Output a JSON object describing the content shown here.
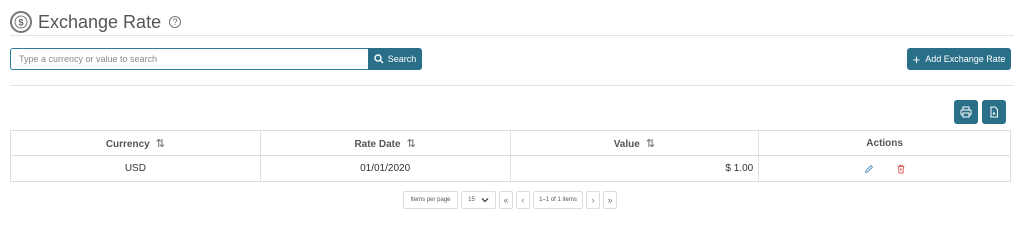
{
  "header": {
    "title": "Exchange Rate",
    "help_symbol": "?"
  },
  "search": {
    "placeholder": "Type a currency or value to search",
    "button_label": "Search"
  },
  "toolbar": {
    "add_label": "Add Exchange Rate",
    "add_symbol": "+"
  },
  "table": {
    "columns": [
      "Currency",
      "Rate Date",
      "Value",
      "Actions"
    ],
    "sort_symbol": "⇅",
    "rows": [
      {
        "currency": "USD",
        "rate_date": "01/01/2020",
        "value": "$ 1.00"
      }
    ]
  },
  "pagination": {
    "items_per_page_label": "Items per page",
    "page_size": "15",
    "first": "«",
    "prev": "‹",
    "range": "1–1 of 1 items",
    "next": "›",
    "last": "»"
  },
  "colors": {
    "primary": "#2a6f88",
    "edit": "#4a90c8",
    "delete": "#e05a5a",
    "border": "#dedede"
  },
  "icons": [
    "dollar-circle-icon",
    "help-icon",
    "search-icon",
    "plus-icon",
    "print-icon",
    "pdf-icon",
    "sort-icon",
    "pencil-icon",
    "trash-icon",
    "chevron-down-icon"
  ]
}
